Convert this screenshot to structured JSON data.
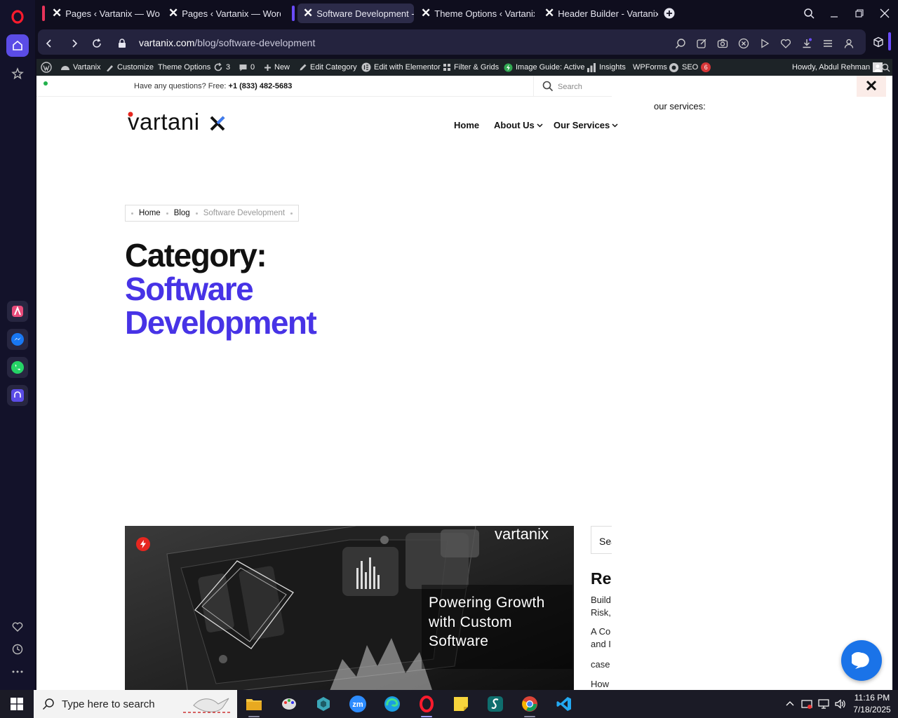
{
  "browser": {
    "tabs": [
      {
        "title": "Pages ‹ Vartanix — WordP",
        "accent": "#e8345a"
      },
      {
        "title": "Pages ‹ Vartanix — WordP",
        "accent": ""
      },
      {
        "title": "Software Development - V",
        "accent": "#6a4cff",
        "active": true
      },
      {
        "title": "Theme Options ‹ Vartanix",
        "accent": ""
      },
      {
        "title": "Header Builder - Vartanix",
        "accent": ""
      }
    ],
    "url_domain": "vartanix.com",
    "url_path": "/blog/software-development"
  },
  "wp_admin_bar": {
    "site_name": "Vartanix",
    "customize": "Customize",
    "theme_options": "Theme Options",
    "updates_count": "3",
    "comments_count": "0",
    "new": "New",
    "edit_category": "Edit Category",
    "edit_elementor": "Edit with Elementor",
    "filter_grids": "Filter & Grids",
    "image_guide": "Image Guide: Active",
    "insights": "Insights",
    "wpforms": "WPForms",
    "seo": "SEO",
    "seo_badge": "6",
    "howdy": "Howdy, Abdul Rehman"
  },
  "site": {
    "top_bar": {
      "question": "Have any questions? Free:",
      "phone": "+1 (833) 482-5683",
      "search_placeholder": "Search"
    },
    "logo_text": "vartani",
    "nav": {
      "home": "Home",
      "about": "About Us",
      "services": "Our Services"
    },
    "services_label": "our services:",
    "breadcrumb": {
      "home": "Home",
      "blog": "Blog",
      "current": "Software Development"
    },
    "title": {
      "prefix": "Category:",
      "line1": "Software",
      "line2": "Development"
    },
    "featured": {
      "text_line1": "Powering Growth",
      "text_line2": "with Custom",
      "text_line3": "Software",
      "brand": "vartanix"
    },
    "sidebar": {
      "search": "Search",
      "heading": "Recent Posts",
      "lines": [
        "Build",
        "Risk,",
        "A Co",
        "and I",
        "case",
        "How"
      ]
    }
  },
  "taskbar": {
    "search_placeholder": "Type here to search",
    "time": "11:16 PM",
    "date": "7/18/2025"
  },
  "colors": {
    "accent": "#4733e6",
    "opera_red": "#ff1b2d",
    "chat_blue": "#1a73e8"
  }
}
